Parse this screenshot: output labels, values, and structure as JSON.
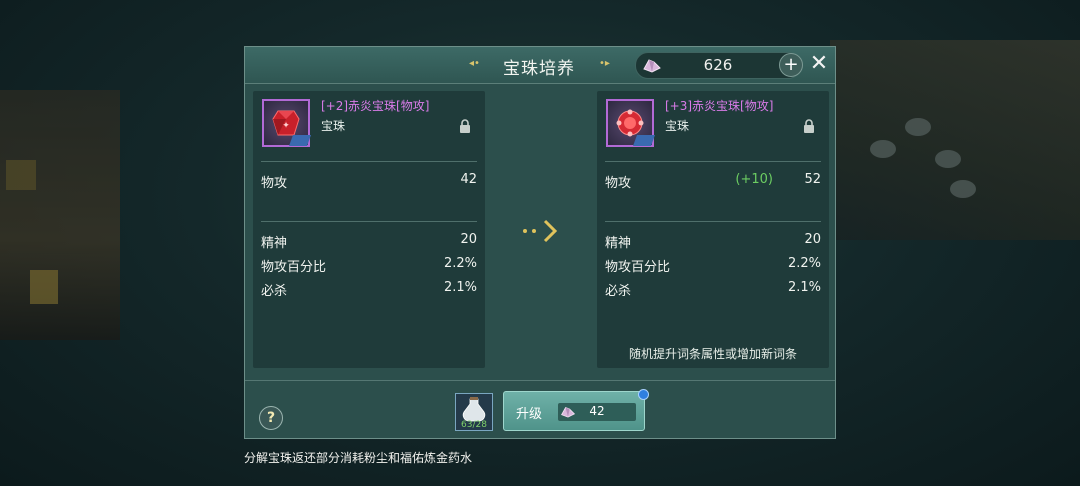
{
  "panel": {
    "title": "宝珠培养",
    "currency_icon": "crystal-icon",
    "currency_value": "626",
    "plus_label": "+",
    "close_label": "✕"
  },
  "left_card": {
    "name": "[+2]赤炎宝珠[物攻]",
    "type": "宝珠",
    "main_stat": {
      "label": "物攻",
      "value": "42"
    },
    "stats": [
      {
        "label": "精神",
        "value": "20"
      },
      {
        "label": "物攻百分比",
        "value": "2.2%"
      },
      {
        "label": "必杀",
        "value": "2.1%"
      }
    ]
  },
  "right_card": {
    "name": "[+3]赤炎宝珠[物攻]",
    "type": "宝珠",
    "main_stat": {
      "label": "物攻",
      "bonus": "(+10)",
      "value": "52"
    },
    "stats": [
      {
        "label": "精神",
        "value": "20"
      },
      {
        "label": "物攻百分比",
        "value": "2.2%"
      },
      {
        "label": "必杀",
        "value": "2.1%"
      }
    ],
    "note": "随机提升词条属性或增加新词条"
  },
  "footer": {
    "help_label": "?",
    "potion_count": "63/28",
    "upgrade_label": "升级",
    "cost_value": "42"
  },
  "bottom_text": "分解宝珠返还部分消耗粉尘和福佑炼金药水",
  "colors": {
    "item_name": "#d87be8",
    "bonus": "#6ccd62",
    "accent": "#d8c46c"
  }
}
